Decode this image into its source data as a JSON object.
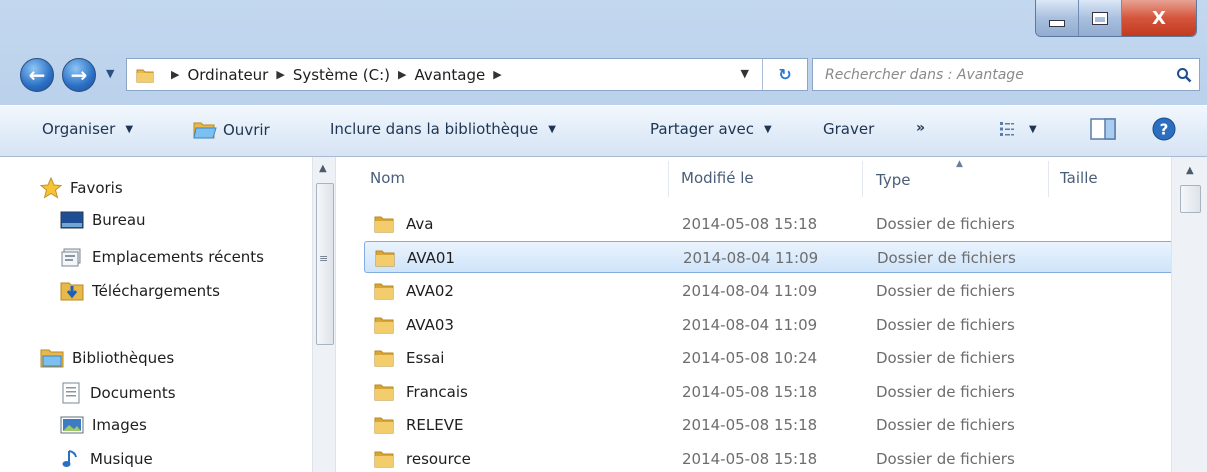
{
  "titlebar": {
    "close_label": "X"
  },
  "address": {
    "crumbs": [
      "Ordinateur",
      "Système (C:)",
      "Avantage"
    ]
  },
  "search": {
    "placeholder": "Rechercher dans : Avantage"
  },
  "commands": {
    "organiser": "Organiser",
    "ouvrir": "Ouvrir",
    "inclure": "Inclure dans la bibliothèque",
    "partager": "Partager avec",
    "graver": "Graver",
    "more": "»"
  },
  "nav": {
    "favoris": "Favoris",
    "bureau": "Bureau",
    "recent": "Emplacements récents",
    "downloads": "Téléchargements",
    "libraries": "Bibliothèques",
    "documents": "Documents",
    "images": "Images",
    "music": "Musique"
  },
  "columns": {
    "name": "Nom",
    "modified": "Modifié le",
    "type": "Type",
    "size": "Taille"
  },
  "files": [
    {
      "name": "Ava",
      "modified": "2014-05-08 15:18",
      "type": "Dossier de fichiers"
    },
    {
      "name": "AVA01",
      "modified": "2014-08-04 11:09",
      "type": "Dossier de fichiers",
      "selected": true
    },
    {
      "name": "AVA02",
      "modified": "2014-08-04 11:09",
      "type": "Dossier de fichiers"
    },
    {
      "name": "AVA03",
      "modified": "2014-08-04 11:09",
      "type": "Dossier de fichiers"
    },
    {
      "name": "Essai",
      "modified": "2014-05-08 10:24",
      "type": "Dossier de fichiers"
    },
    {
      "name": "Francais",
      "modified": "2014-05-08 15:18",
      "type": "Dossier de fichiers"
    },
    {
      "name": "RELEVE",
      "modified": "2014-05-08 15:18",
      "type": "Dossier de fichiers"
    },
    {
      "name": "resource",
      "modified": "2014-05-08 15:18",
      "type": "Dossier de fichiers"
    }
  ],
  "colors": {
    "selection": "#cfe4fa",
    "selection_border": "#84acdd",
    "folder": "#e8b84a"
  }
}
